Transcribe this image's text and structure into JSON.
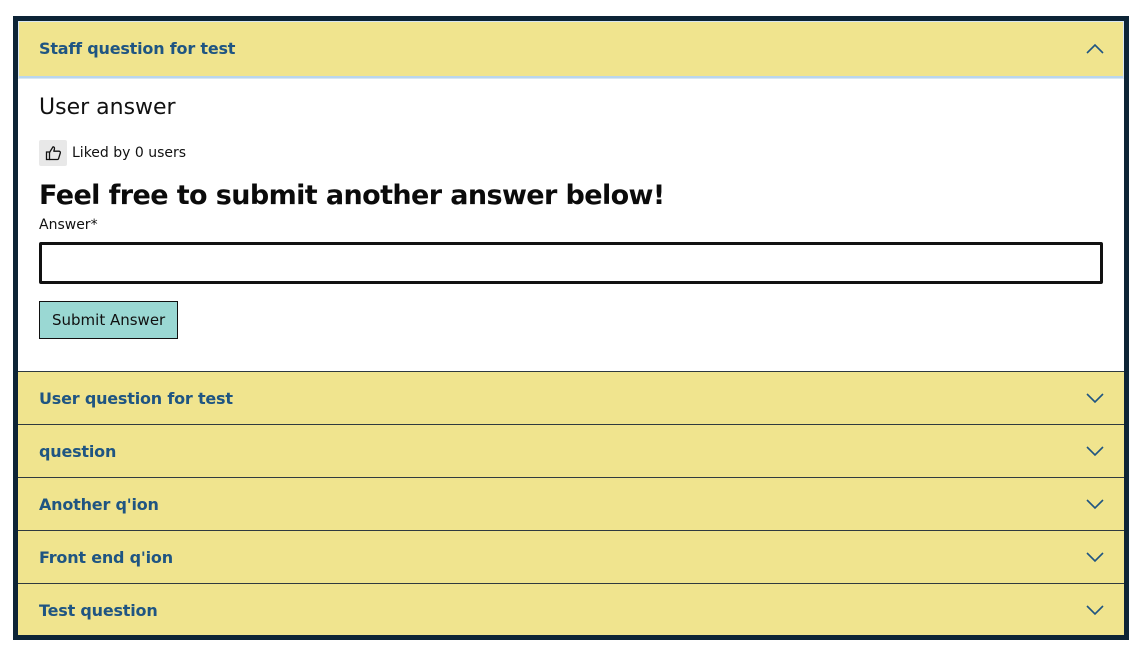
{
  "accordion": {
    "open_item": {
      "title": "Staff question for test",
      "answer": "User answer",
      "liked_text": "Liked by 0 users",
      "form": {
        "heading": "Feel free to submit another answer below!",
        "label": "Answer*",
        "input_value": "",
        "submit_label": "Submit Answer"
      }
    },
    "items": [
      {
        "title": "User question for test"
      },
      {
        "title": "question"
      },
      {
        "title": "Another q'ion"
      },
      {
        "title": "Front end q'ion"
      },
      {
        "title": "Test question"
      }
    ]
  },
  "colors": {
    "header_bg": "#f0e48e",
    "title_text": "#1f5582",
    "submit_bg": "#9ad8d3",
    "frame_border": "#0d2436"
  },
  "icons": {
    "collapse": "chevron-up-icon",
    "expand": "chevron-down-icon",
    "like": "thumbs-up-icon"
  }
}
